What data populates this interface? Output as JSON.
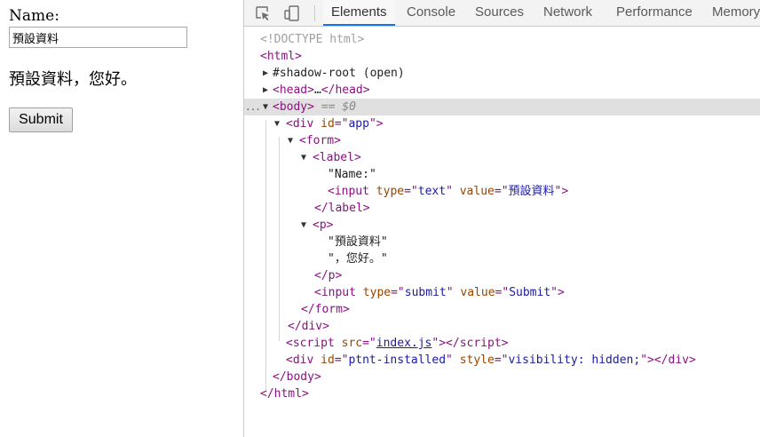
{
  "page": {
    "name_label": "Name:",
    "input_value": "預設資料",
    "greeting_value": "預設資料",
    "greeting_suffix": "，您好。",
    "submit_label": "Submit"
  },
  "devtools": {
    "tabs": [
      {
        "label": "Elements",
        "active": true
      },
      {
        "label": "Console",
        "active": false
      },
      {
        "label": "Sources",
        "active": false
      },
      {
        "label": "Network",
        "active": false
      },
      {
        "label": "Performance",
        "active": false
      },
      {
        "label": "Memory",
        "active": false
      }
    ],
    "tree": {
      "doctype": "<!DOCTYPE html>",
      "html_open": "html",
      "shadow_root": "#shadow-root (open)",
      "head_tag": "head",
      "head_ellipsis": "…",
      "body_tag": "body",
      "body_marker": "== $0",
      "selected_dots": "...",
      "div_tag": "div",
      "id_attr": "id",
      "div_id": "app",
      "form_tag": "form",
      "label_tag": "label",
      "label_text": "\"Name:\"",
      "input_tag": "input",
      "type_attr": "type",
      "value_attr": "value",
      "input_type": "text",
      "input_value": "預設資料",
      "p_tag": "p",
      "p_text_1": "\"預設資料\"",
      "p_text_2": "\"，您好。\"",
      "submit_type": "submit",
      "submit_value": "Submit",
      "script_tag": "script",
      "src_attr": "src",
      "script_src": "index.js",
      "installed_id": "ptnt-installed",
      "style_attr": "style",
      "style_value": "visibility: hidden;"
    }
  }
}
